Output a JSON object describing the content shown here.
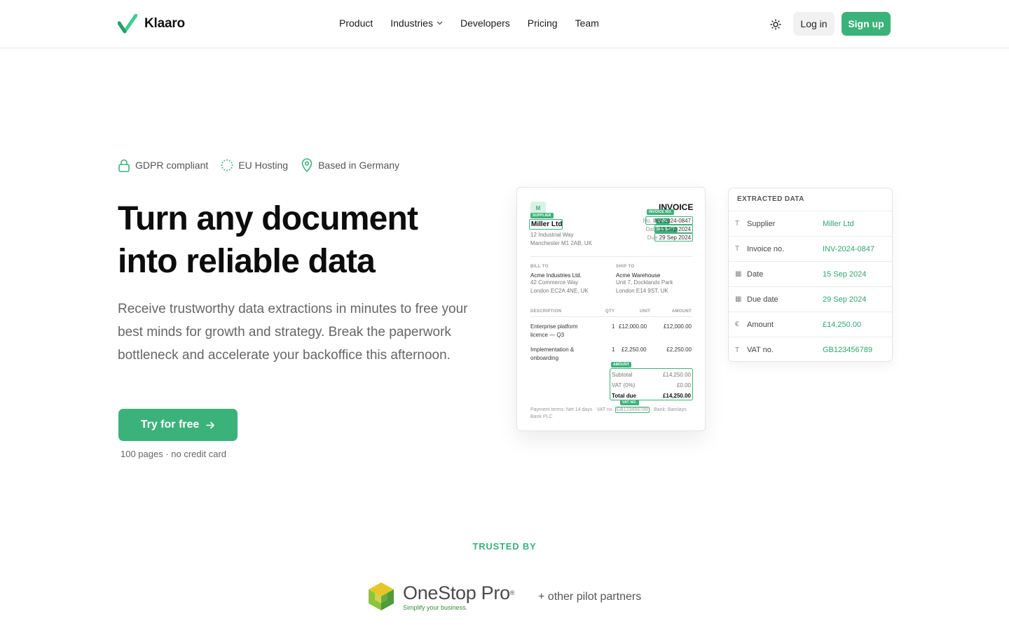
{
  "nav": {
    "brand": "Klaaro",
    "links": [
      "Product",
      "Industries",
      "Developers",
      "Pricing",
      "Team"
    ],
    "login": "Log in",
    "signup": "Sign up"
  },
  "badges": [
    "GDPR compliant",
    "EU Hosting",
    "Based in Germany"
  ],
  "hero": {
    "title_line1": "Turn any document",
    "title_line2": "into reliable data",
    "subtitle": "Receive trustworthy data extractions in minutes to free your best minds for growth and strategy. Break the paperwork bottleneck and accelerate your backoffice this afternoon.",
    "cta": "Try for free",
    "cta_note": "100 pages · no credit card"
  },
  "invoice": {
    "logo_letter": "M",
    "title": "INVOICE",
    "supplier": "Miller Ltd",
    "supplier_addr1": "12 Industrial Way",
    "supplier_addr2": "Manchester M1 2AB, UK",
    "no_label": "No.",
    "no_value": "INV-2024-0847",
    "date_label": "Date",
    "date_value": "15 Sep 2024",
    "due_label": "Due",
    "due_value": "29 Sep 2024",
    "tags": {
      "supplier": "SUPPLIER",
      "invoice_no": "INVOICE NO.",
      "date": "DATE",
      "due_date": "DUE DATE",
      "amount": "AMOUNT",
      "vat_no": "VAT NO."
    },
    "bill_to_label": "BILL TO",
    "bill_to_name": "Acme Industries Ltd.",
    "bill_to_addr1": "42 Commerce Way",
    "bill_to_addr2": "London EC2A 4NE, UK",
    "ship_to_label": "SHIP TO",
    "ship_to_name": "Acme Warehouse",
    "ship_to_addr1": "Unit 7, Docklands Park",
    "ship_to_addr2": "London E14 9ST, UK",
    "headers": [
      "DESCRIPTION",
      "QTY",
      "UNIT",
      "AMOUNT"
    ],
    "items": [
      {
        "desc1": "Enterprise platform",
        "desc2": "licence — Q3",
        "qty": "1",
        "unit": "£12,000.00",
        "amount": "£12,000.00"
      },
      {
        "desc1": "Implementation &",
        "desc2": "onboarding",
        "qty": "1",
        "unit": "£2,250.00",
        "amount": "£2,250.00"
      }
    ],
    "subtotal_label": "Subtotal",
    "subtotal_value": "£14,250.00",
    "vat_label": "VAT (0%)",
    "vat_value": "£0.00",
    "total_label": "Total due",
    "total_value": "£14,250.00",
    "footer_pre": "Payment terms: Net 14 days · VAT no.",
    "footer_vat": "GB123456789",
    "footer_post": "· Bank: Barclays Bank PLC"
  },
  "extracted": {
    "heading": "EXTRACTED DATA",
    "rows": [
      {
        "icon": "text-icon",
        "glyph": "T",
        "key": "Supplier",
        "value": "Miller Ltd"
      },
      {
        "icon": "text-icon",
        "glyph": "T",
        "key": "Invoice no.",
        "value": "INV-2024-0847"
      },
      {
        "icon": "calendar-icon",
        "glyph": "▦",
        "key": "Date",
        "value": "15 Sep 2024"
      },
      {
        "icon": "calendar-icon",
        "glyph": "▦",
        "key": "Due date",
        "value": "29 Sep 2024"
      },
      {
        "icon": "euro-icon",
        "glyph": "€",
        "key": "Amount",
        "value": "£14,250.00"
      },
      {
        "icon": "text-icon",
        "glyph": "T",
        "key": "VAT no.",
        "value": "GB123456789"
      }
    ]
  },
  "trusted": {
    "label": "TRUSTED BY",
    "partner_name": "OneStop Pro",
    "partner_reg": "®",
    "partner_tagline": "Simplify your business.",
    "more": "+ other pilot partners"
  },
  "colors": {
    "accent": "#3bb27a",
    "accent_text": "#2fa66f",
    "text": "#111111",
    "muted": "#666666"
  }
}
